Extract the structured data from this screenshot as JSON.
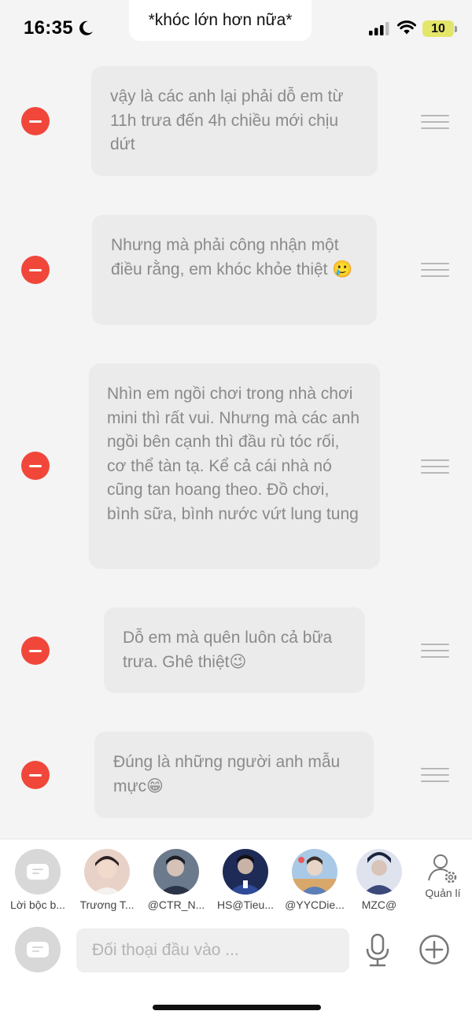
{
  "status": {
    "time": "16:35",
    "battery": "10"
  },
  "banner": {
    "text": "*khóc lớn hơn nữa*"
  },
  "messages": [
    {
      "text": "vậy là các anh lại phải dỗ em từ 11h trưa đến 4h chiều mới chịu dứt"
    },
    {
      "text": "Nhưng mà phải công nhận một điều rằng, em khóc khỏe thiệt 🥲"
    },
    {
      "text": "Nhìn em ngồi chơi trong nhà chơi mini thì rất vui. Nhưng mà các anh ngồi bên cạnh thì đầu rù tóc rối, cơ thể tàn tạ. Kể cả cái nhà nó cũng tan hoang theo. Đồ chơi, bình sữa, bình nước vứt lung tung"
    },
    {
      "text": "Dỗ em mà quên luôn cả bữa trưa. Ghê thiệt😉"
    },
    {
      "text": "Đúng là những người anh mẫu mực😁"
    }
  ],
  "characters": [
    {
      "label": "Lời bộc b...",
      "color": "#d8d8d8"
    },
    {
      "label": "Trương T...",
      "color": "#d9b7a7"
    },
    {
      "label": "@CTR_N...",
      "color": "#4a5668"
    },
    {
      "label": "HS@Tieu...",
      "color": "#2f3f73"
    },
    {
      "label": "@YYCDie...",
      "color": "#8fb4d6"
    },
    {
      "label": "MZC@",
      "color": "#3b4a7a"
    }
  ],
  "manage": {
    "label": "Quản lí"
  },
  "input": {
    "placeholder": "Đối thoại đầu vào ..."
  }
}
